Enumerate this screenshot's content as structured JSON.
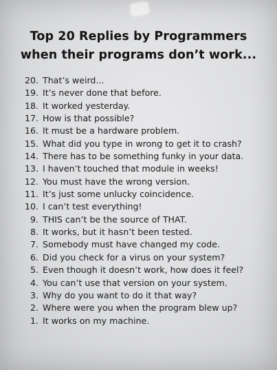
{
  "title": {
    "line1": "Top 20 Replies by Programmers",
    "line2": "when their programs don’t work..."
  },
  "items": [
    {
      "num": "20.",
      "text": "That’s weird..."
    },
    {
      "num": "19.",
      "text": "It’s never done that before."
    },
    {
      "num": "18.",
      "text": "It worked yesterday."
    },
    {
      "num": "17.",
      "text": "How is that possible?"
    },
    {
      "num": "16.",
      "text": "It must be a hardware problem."
    },
    {
      "num": "15.",
      "text": "What did you type in wrong to get it to crash?"
    },
    {
      "num": "14.",
      "text": "There has to be something funky in your data."
    },
    {
      "num": "13.",
      "text": "I haven’t touched that module in weeks!"
    },
    {
      "num": "12.",
      "text": "You must have the wrong version."
    },
    {
      "num": "11.",
      "text": "It’s just some unlucky coincidence."
    },
    {
      "num": "10.",
      "text": "I can’t test everything!"
    },
    {
      "num": "9.",
      "text": "THIS can’t be the source of THAT."
    },
    {
      "num": "8.",
      "text": "It works, but it hasn’t been tested."
    },
    {
      "num": "7.",
      "text": "Somebody must have changed my code."
    },
    {
      "num": "6.",
      "text": "Did you check for a virus on your system?"
    },
    {
      "num": "5.",
      "text": "Even though it doesn’t work, how does it feel?"
    },
    {
      "num": "4.",
      "text": "You can’t use that version on your system."
    },
    {
      "num": "3.",
      "text": "Why do you want to do it that way?"
    },
    {
      "num": "2.",
      "text": "Where were you when the program blew up?"
    },
    {
      "num": "1.",
      "text": "It works on my machine."
    }
  ]
}
